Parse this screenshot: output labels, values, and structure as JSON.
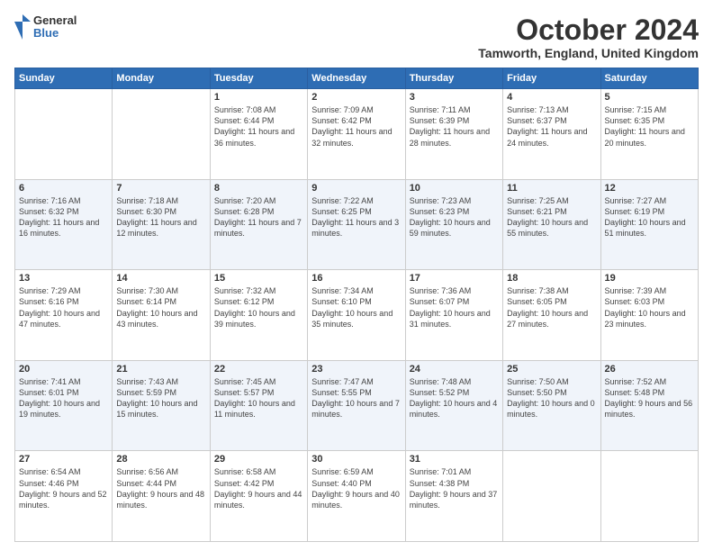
{
  "header": {
    "logo_general": "General",
    "logo_blue": "Blue",
    "month_title": "October 2024",
    "location": "Tamworth, England, United Kingdom"
  },
  "days_of_week": [
    "Sunday",
    "Monday",
    "Tuesday",
    "Wednesday",
    "Thursday",
    "Friday",
    "Saturday"
  ],
  "weeks": [
    [
      {
        "day": "",
        "info": ""
      },
      {
        "day": "",
        "info": ""
      },
      {
        "day": "1",
        "info": "Sunrise: 7:08 AM\nSunset: 6:44 PM\nDaylight: 11 hours and 36 minutes."
      },
      {
        "day": "2",
        "info": "Sunrise: 7:09 AM\nSunset: 6:42 PM\nDaylight: 11 hours and 32 minutes."
      },
      {
        "day": "3",
        "info": "Sunrise: 7:11 AM\nSunset: 6:39 PM\nDaylight: 11 hours and 28 minutes."
      },
      {
        "day": "4",
        "info": "Sunrise: 7:13 AM\nSunset: 6:37 PM\nDaylight: 11 hours and 24 minutes."
      },
      {
        "day": "5",
        "info": "Sunrise: 7:15 AM\nSunset: 6:35 PM\nDaylight: 11 hours and 20 minutes."
      }
    ],
    [
      {
        "day": "6",
        "info": "Sunrise: 7:16 AM\nSunset: 6:32 PM\nDaylight: 11 hours and 16 minutes."
      },
      {
        "day": "7",
        "info": "Sunrise: 7:18 AM\nSunset: 6:30 PM\nDaylight: 11 hours and 12 minutes."
      },
      {
        "day": "8",
        "info": "Sunrise: 7:20 AM\nSunset: 6:28 PM\nDaylight: 11 hours and 7 minutes."
      },
      {
        "day": "9",
        "info": "Sunrise: 7:22 AM\nSunset: 6:25 PM\nDaylight: 11 hours and 3 minutes."
      },
      {
        "day": "10",
        "info": "Sunrise: 7:23 AM\nSunset: 6:23 PM\nDaylight: 10 hours and 59 minutes."
      },
      {
        "day": "11",
        "info": "Sunrise: 7:25 AM\nSunset: 6:21 PM\nDaylight: 10 hours and 55 minutes."
      },
      {
        "day": "12",
        "info": "Sunrise: 7:27 AM\nSunset: 6:19 PM\nDaylight: 10 hours and 51 minutes."
      }
    ],
    [
      {
        "day": "13",
        "info": "Sunrise: 7:29 AM\nSunset: 6:16 PM\nDaylight: 10 hours and 47 minutes."
      },
      {
        "day": "14",
        "info": "Sunrise: 7:30 AM\nSunset: 6:14 PM\nDaylight: 10 hours and 43 minutes."
      },
      {
        "day": "15",
        "info": "Sunrise: 7:32 AM\nSunset: 6:12 PM\nDaylight: 10 hours and 39 minutes."
      },
      {
        "day": "16",
        "info": "Sunrise: 7:34 AM\nSunset: 6:10 PM\nDaylight: 10 hours and 35 minutes."
      },
      {
        "day": "17",
        "info": "Sunrise: 7:36 AM\nSunset: 6:07 PM\nDaylight: 10 hours and 31 minutes."
      },
      {
        "day": "18",
        "info": "Sunrise: 7:38 AM\nSunset: 6:05 PM\nDaylight: 10 hours and 27 minutes."
      },
      {
        "day": "19",
        "info": "Sunrise: 7:39 AM\nSunset: 6:03 PM\nDaylight: 10 hours and 23 minutes."
      }
    ],
    [
      {
        "day": "20",
        "info": "Sunrise: 7:41 AM\nSunset: 6:01 PM\nDaylight: 10 hours and 19 minutes."
      },
      {
        "day": "21",
        "info": "Sunrise: 7:43 AM\nSunset: 5:59 PM\nDaylight: 10 hours and 15 minutes."
      },
      {
        "day": "22",
        "info": "Sunrise: 7:45 AM\nSunset: 5:57 PM\nDaylight: 10 hours and 11 minutes."
      },
      {
        "day": "23",
        "info": "Sunrise: 7:47 AM\nSunset: 5:55 PM\nDaylight: 10 hours and 7 minutes."
      },
      {
        "day": "24",
        "info": "Sunrise: 7:48 AM\nSunset: 5:52 PM\nDaylight: 10 hours and 4 minutes."
      },
      {
        "day": "25",
        "info": "Sunrise: 7:50 AM\nSunset: 5:50 PM\nDaylight: 10 hours and 0 minutes."
      },
      {
        "day": "26",
        "info": "Sunrise: 7:52 AM\nSunset: 5:48 PM\nDaylight: 9 hours and 56 minutes."
      }
    ],
    [
      {
        "day": "27",
        "info": "Sunrise: 6:54 AM\nSunset: 4:46 PM\nDaylight: 9 hours and 52 minutes."
      },
      {
        "day": "28",
        "info": "Sunrise: 6:56 AM\nSunset: 4:44 PM\nDaylight: 9 hours and 48 minutes."
      },
      {
        "day": "29",
        "info": "Sunrise: 6:58 AM\nSunset: 4:42 PM\nDaylight: 9 hours and 44 minutes."
      },
      {
        "day": "30",
        "info": "Sunrise: 6:59 AM\nSunset: 4:40 PM\nDaylight: 9 hours and 40 minutes."
      },
      {
        "day": "31",
        "info": "Sunrise: 7:01 AM\nSunset: 4:38 PM\nDaylight: 9 hours and 37 minutes."
      },
      {
        "day": "",
        "info": ""
      },
      {
        "day": "",
        "info": ""
      }
    ]
  ]
}
